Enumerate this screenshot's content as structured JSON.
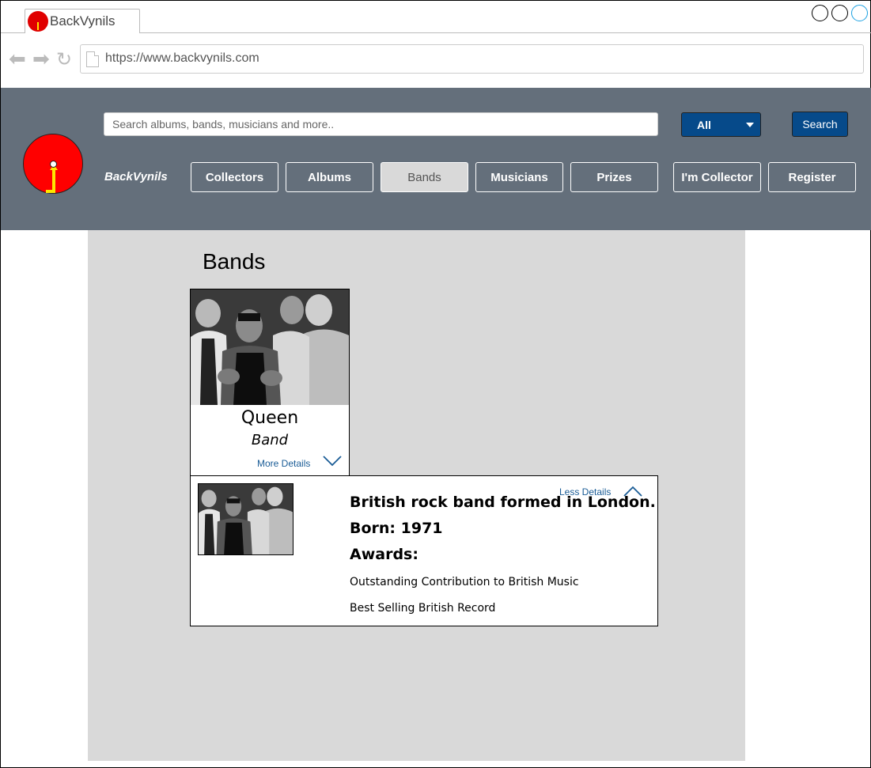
{
  "browser": {
    "tab_title": "BackVynils",
    "url": "https://www.backvynils.com"
  },
  "header": {
    "search_placeholder": "Search albums, bands, musicians and more..",
    "filter_selected": "All",
    "search_button": "Search",
    "brand": "BackVynils",
    "nav": [
      {
        "label": "Collectors"
      },
      {
        "label": "Albums"
      },
      {
        "label": "Bands",
        "active": true
      },
      {
        "label": "Musicians"
      },
      {
        "label": "Prizes"
      },
      {
        "label": "I'm Collector"
      },
      {
        "label": "Register"
      }
    ]
  },
  "main": {
    "title": "Bands",
    "band": {
      "name": "Queen",
      "type": "Band",
      "more_details": "More Details"
    },
    "details": {
      "less_details": "Less Details",
      "description": "British rock band formed in London.",
      "born": "Born: 1971",
      "awards_heading": "Awards:",
      "awards": [
        "Outstanding Contribution to British Music",
        "Best Selling British Record"
      ]
    }
  },
  "colors": {
    "header_bg": "#646f7b",
    "content_bg": "#d9d9d9",
    "primary_button": "#064a8a",
    "link": "#1a5c96",
    "logo_red": "#ff0000",
    "logo_yellow": "#ffe600"
  },
  "icons": {
    "back": "arrow-left-icon",
    "forward": "arrow-right-icon",
    "reload": "reload-icon",
    "page": "page-icon",
    "expand": "chevron-down-icon",
    "collapse": "chevron-up-icon"
  }
}
